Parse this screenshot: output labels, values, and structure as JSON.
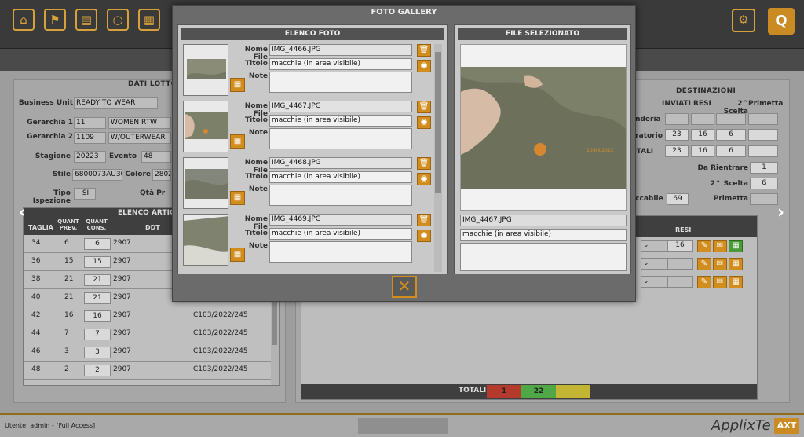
{
  "topbar": {
    "icons": [
      "home-icon",
      "shirt-icon",
      "document-icon",
      "chat-icon",
      "image-icon"
    ],
    "settings_icon": "gear-icon",
    "logo_letter": "Q"
  },
  "dati_lotto": {
    "title": "DATI LOTTO",
    "business_unit_label": "Business Unit",
    "business_unit": "READY TO WEAR",
    "gerarchia1_label": "Gerarchia 1",
    "gerarchia1_code": "11",
    "gerarchia1_name": "WOMEN RTW",
    "gerarchia2_label": "Gerarchia 2",
    "gerarchia2_code": "1109",
    "gerarchia2_name": "W/OUTERWEAR",
    "stagione_label": "Stagione",
    "stagione": "20223",
    "evento_label": "Evento",
    "evento": "48",
    "stile_label": "Stile",
    "stile": "6800073AU30",
    "colore_label": "Colore",
    "colore": "2802",
    "tipo_ispezione_label": "Tipo Ispezione",
    "tipo_ispezione": "SI",
    "qta_label": "Qtà Pr"
  },
  "articoli": {
    "title": "ELENCO ARTICOL",
    "headers": [
      "TAGLIA",
      "QUANT PREV.",
      "QUANT CONS.",
      "DDT"
    ],
    "rows": [
      {
        "taglia": "34",
        "prev": "6",
        "cons": "6",
        "ddt": "2907",
        "doc": ""
      },
      {
        "taglia": "36",
        "prev": "15",
        "cons": "15",
        "ddt": "2907",
        "doc": ""
      },
      {
        "taglia": "38",
        "prev": "21",
        "cons": "21",
        "ddt": "2907",
        "doc": ""
      },
      {
        "taglia": "40",
        "prev": "21",
        "cons": "21",
        "ddt": "2907",
        "doc": ""
      },
      {
        "taglia": "42",
        "prev": "16",
        "cons": "16",
        "ddt": "2907",
        "doc": "C103/2022/245"
      },
      {
        "taglia": "44",
        "prev": "7",
        "cons": "7",
        "ddt": "2907",
        "doc": "C103/2022/245"
      },
      {
        "taglia": "46",
        "prev": "3",
        "cons": "3",
        "ddt": "2907",
        "doc": "C103/2022/245"
      },
      {
        "taglia": "48",
        "prev": "2",
        "cons": "2",
        "ddt": "2907",
        "doc": "C103/2022/245"
      }
    ]
  },
  "destinazioni": {
    "title": "DESTINAZIONI",
    "headers": [
      "INVIATI",
      "RESI",
      "2^ Scelta",
      "Primetta"
    ],
    "row_labels": [
      "anderia",
      "oratorio",
      "OTALI"
    ],
    "rows": [
      [
        "",
        "",
        "",
        ""
      ],
      [
        "23",
        "16",
        "6",
        ""
      ],
      [
        "23",
        "16",
        "6",
        ""
      ]
    ],
    "da_rientrare_label": "Da Rientrare",
    "da_rientrare": "1",
    "seconda_scelta_label": "2^ Scelta",
    "seconda_scelta": "6",
    "occabile_label": "occabile",
    "occabile": "69",
    "primetta_label": "Primetta"
  },
  "resi_panel": {
    "header": "RESI",
    "row1_value": "16",
    "totali_label": "TOTALI",
    "tot_red": "1",
    "tot_green": "22",
    "tot_yellow": ""
  },
  "status": {
    "user": "Utente: admin - [Full Access]",
    "brand": "ApplixTe",
    "brand_tag": "AXT"
  },
  "modal": {
    "title": "FOTO GALLERY",
    "list_title": "ELENCO FOTO",
    "selected_title": "FILE SELEZIONATO",
    "nome_file_label": "Nome File",
    "titolo_label": "Titolo",
    "note_label": "Note",
    "photos": [
      {
        "file": "IMG_4466.JPG",
        "titolo": "macchie (in area visibile)"
      },
      {
        "file": "IMG_4467.JPG",
        "titolo": "macchie (in area visibile)"
      },
      {
        "file": "IMG_4468.JPG",
        "titolo": "macchie (in area visibile)"
      },
      {
        "file": "IMG_4469.JPG",
        "titolo": "macchie (in area visibile)"
      }
    ],
    "selected_file": "IMG_4467.JPG",
    "selected_titolo": "macchie (in area visibile)",
    "selected_note": "",
    "photo_date_stamp": "10/08/2022",
    "close_icon": "close-icon"
  },
  "colors": {
    "accent": "#d18e1f",
    "red": "#c33a2a",
    "green": "#56b84a",
    "yellow": "#cfc43a"
  }
}
